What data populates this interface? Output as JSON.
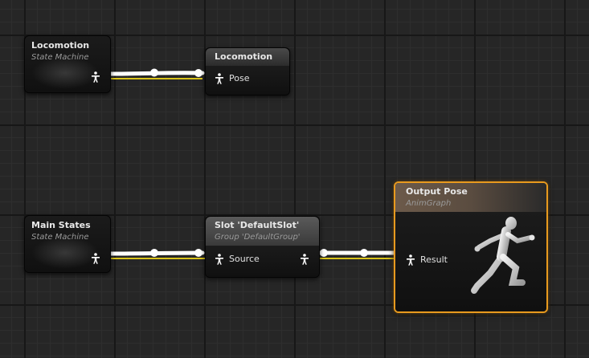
{
  "nodes": {
    "locomotion_sm": {
      "title": "Locomotion",
      "subtitle": "State Machine"
    },
    "locomotion_out": {
      "title": "Locomotion",
      "pin": "Pose"
    },
    "main_states_sm": {
      "title": "Main States",
      "subtitle": "State Machine"
    },
    "slot": {
      "title": "Slot 'DefaultSlot'",
      "subtitle": "Group 'DefaultGroup'",
      "pin": "Source"
    },
    "output_pose": {
      "title": "Output Pose",
      "subtitle": "AnimGraph",
      "pin": "Result"
    }
  },
  "colors": {
    "wire": "#ffffff",
    "wire_underline": "#d8c21a",
    "output_border": "#e89a1e"
  },
  "icons": [
    "pose-pin-icon",
    "running-mannequin-icon"
  ]
}
